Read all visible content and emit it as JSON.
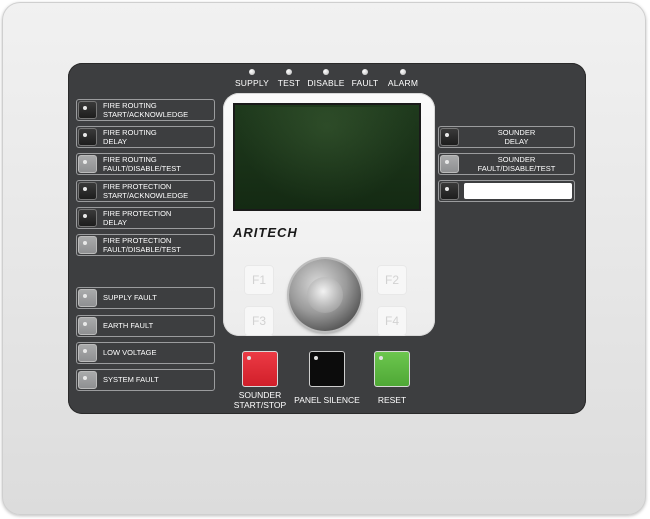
{
  "status_indicators": [
    "SUPPLY",
    "TEST",
    "DISABLE",
    "FAULT",
    "ALARM"
  ],
  "left_zones": [
    {
      "lines": [
        "FIRE ROUTING",
        "START/ACKNOWLEDGE"
      ],
      "button": "dark"
    },
    {
      "lines": [
        "FIRE ROUTING",
        "DELAY"
      ],
      "button": "dark"
    },
    {
      "lines": [
        "FIRE ROUTING",
        "FAULT/DISABLE/TEST"
      ],
      "button": "grey"
    },
    {
      "lines": [
        "FIRE PROTECTION",
        "START/ACKNOWLEDGE"
      ],
      "button": "dark"
    },
    {
      "lines": [
        "FIRE PROTECTION",
        "DELAY"
      ],
      "button": "dark"
    },
    {
      "lines": [
        "FIRE PROTECTION",
        "FAULT/DISABLE/TEST"
      ],
      "button": "grey"
    }
  ],
  "fault_indicators": [
    "SUPPLY FAULT",
    "EARTH FAULT",
    "LOW VOLTAGE",
    "SYSTEM FAULT"
  ],
  "right_zones": [
    {
      "lines": [
        "SOUNDER",
        "DELAY"
      ],
      "button": "dark"
    },
    {
      "lines": [
        "SOUNDER",
        "FAULT/DISABLE/TEST"
      ],
      "button": "grey"
    },
    {
      "lines": [
        "",
        ""
      ],
      "button": "dark",
      "blank_label": true
    }
  ],
  "brand": "ARITECH",
  "function_keys": [
    "F1",
    "F2",
    "F3",
    "F4"
  ],
  "controls": [
    {
      "lines": [
        "SOUNDER",
        "START/STOP"
      ],
      "color": "#e2242f"
    },
    {
      "lines": [
        "PANEL SILENCE",
        ""
      ],
      "color": "#0c0c0c"
    },
    {
      "lines": [
        "RESET",
        ""
      ],
      "color": "#5cb83f"
    }
  ]
}
